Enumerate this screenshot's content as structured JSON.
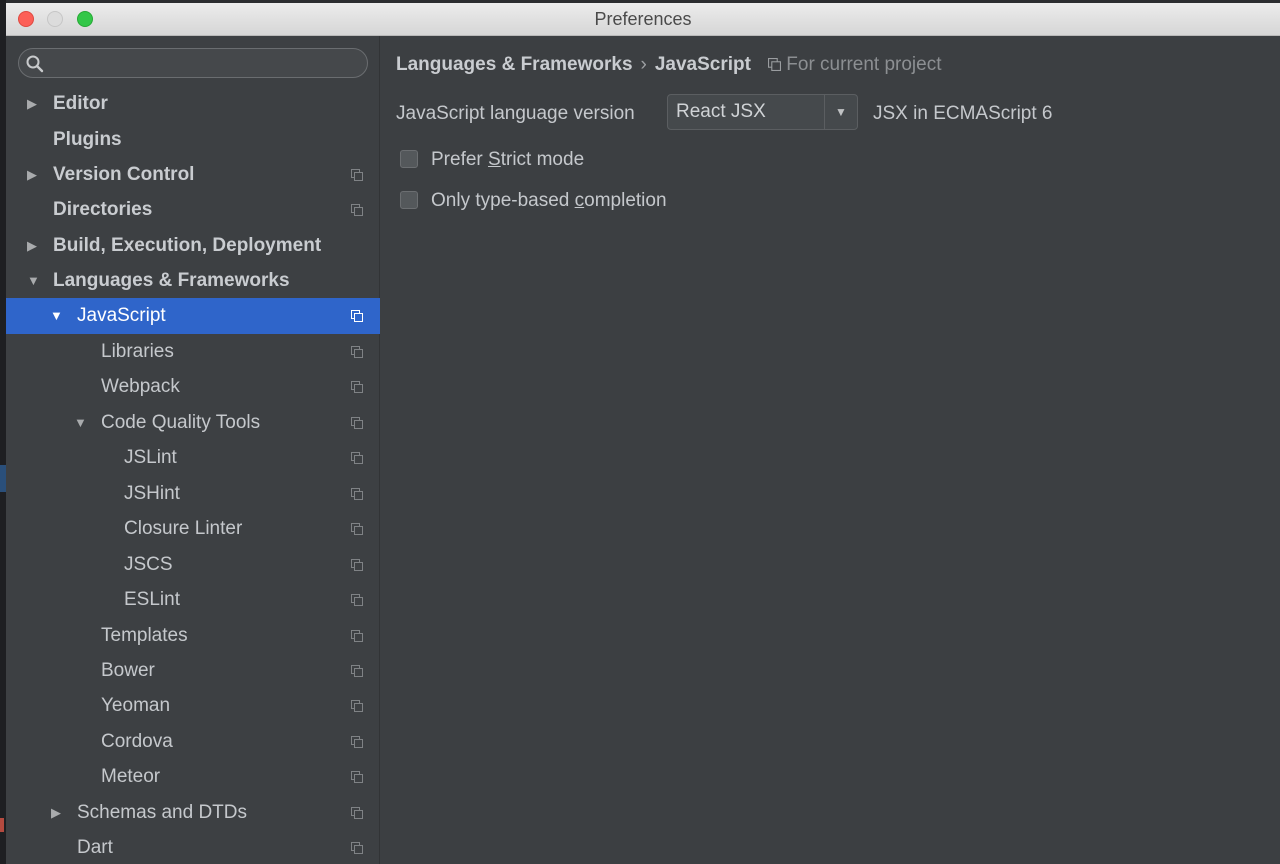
{
  "window": {
    "title": "Preferences"
  },
  "search": {
    "placeholder": ""
  },
  "sidebar": {
    "items": [
      {
        "label": "Editor",
        "arrow": "▶"
      },
      {
        "label": "Plugins",
        "arrow": ""
      },
      {
        "label": "Version Control",
        "arrow": "▶"
      },
      {
        "label": "Directories",
        "arrow": ""
      },
      {
        "label": "Build, Execution, Deployment",
        "arrow": "▶"
      },
      {
        "label": "Languages & Frameworks",
        "arrow": "▼"
      },
      {
        "label": "JavaScript",
        "arrow": "▼"
      },
      {
        "label": "Libraries",
        "arrow": ""
      },
      {
        "label": "Webpack",
        "arrow": ""
      },
      {
        "label": "Code Quality Tools",
        "arrow": "▼"
      },
      {
        "label": "JSLint",
        "arrow": ""
      },
      {
        "label": "JSHint",
        "arrow": ""
      },
      {
        "label": "Closure Linter",
        "arrow": ""
      },
      {
        "label": "JSCS",
        "arrow": ""
      },
      {
        "label": "ESLint",
        "arrow": ""
      },
      {
        "label": "Templates",
        "arrow": ""
      },
      {
        "label": "Bower",
        "arrow": ""
      },
      {
        "label": "Yeoman",
        "arrow": ""
      },
      {
        "label": "Cordova",
        "arrow": ""
      },
      {
        "label": "Meteor",
        "arrow": ""
      },
      {
        "label": "Schemas and DTDs",
        "arrow": "▶"
      },
      {
        "label": "Dart",
        "arrow": ""
      }
    ]
  },
  "breadcrumb": {
    "parent": "Languages & Frameworks",
    "separator": "›",
    "current": "JavaScript",
    "scope": "For current project"
  },
  "settings": {
    "language_version_label": "JavaScript language version",
    "language_version_value": "React JSX",
    "dropdown_glyph": "▼",
    "language_version_hint": "JSX in ECMAScript 6",
    "strict_mode": {
      "before": "Prefer ",
      "mnemonic": "S",
      "after": "trict mode",
      "checked": false
    },
    "type_completion": {
      "before": "Only type-based ",
      "mnemonic": "c",
      "after": "ompletion",
      "checked": false
    }
  },
  "colors": {
    "selection": "#2f65ca",
    "panel": "#3c3f42",
    "sidebar": "#3d4043"
  }
}
